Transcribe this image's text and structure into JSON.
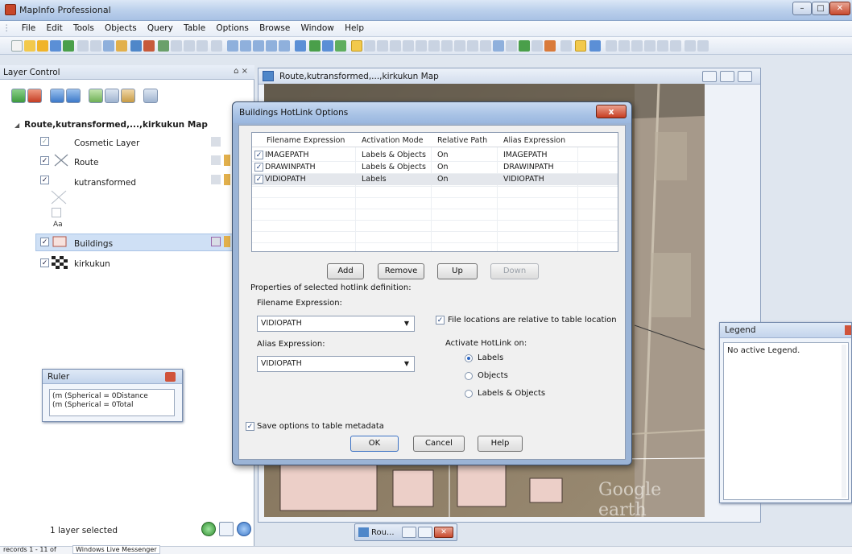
{
  "app": {
    "title": "MapInfo Professional"
  },
  "menu": [
    "File",
    "Edit",
    "Tools",
    "Objects",
    "Query",
    "Table",
    "Options",
    "Browse",
    "Window",
    "Help"
  ],
  "layer_control": {
    "title": "Layer Control",
    "close_glyph": "⌂ ×",
    "map_name": "Route,kutransformed,...,kirkukun Map",
    "layers": [
      {
        "name": "Cosmetic Layer",
        "checked": true
      },
      {
        "name": "Route",
        "checked": true
      },
      {
        "name": "kutransformed",
        "checked": true
      },
      {
        "name": "Buildings",
        "checked": true,
        "selected": true
      },
      {
        "name": "kirkukun",
        "checked": true
      }
    ],
    "sample_text": "Aa",
    "status": "1 layer selected"
  },
  "ruler": {
    "title": "Ruler",
    "lines": [
      "(m (Spherical = 0Distance",
      "(m (Spherical = 0Total"
    ]
  },
  "map_window": {
    "title": "Route,kutransformed,...,kirkukun Map",
    "watermark": "Google earth",
    "taskbar_label": "Rou..."
  },
  "legend": {
    "title": "Legend",
    "body": "No active Legend."
  },
  "dialog": {
    "title": "Buildings HotLink Options",
    "close": "x",
    "columns": [
      "Filename Expression",
      "Activation Mode",
      "Relative Path",
      "Alias Expression"
    ],
    "rows": [
      {
        "filename": "IMAGEPATH",
        "mode": "Labels & Objects",
        "relative": "On",
        "alias": "IMAGEPATH"
      },
      {
        "filename": "DRAWINPATH",
        "mode": "Labels & Objects",
        "relative": "On",
        "alias": "DRAWINPATH"
      },
      {
        "filename": "VIDIOPATH",
        "mode": "Labels",
        "relative": "On",
        "alias": "VIDIOPATH"
      }
    ],
    "buttons": {
      "add": "Add",
      "remove": "Remove",
      "up": "Up",
      "down": "Down"
    },
    "properties_label": "Properties of selected hotlink definition:",
    "filename_label": "Filename Expression:",
    "filename_value": "VIDIOPATH",
    "alias_label": "Alias Expression:",
    "alias_value": "VIDIOPATH",
    "relative_checkbox": "File locations are relative to table location",
    "activate_label": "Activate HotLink on:",
    "activate_options": [
      "Labels",
      "Objects",
      "Labels & Objects"
    ],
    "activate_selected": "Labels",
    "save_checkbox": "Save options to table metadata",
    "ok": "OK",
    "cancel": "Cancel",
    "help": "Help"
  },
  "status_bar": {
    "records": "records 1 - 11 of",
    "messenger": "Windows Live Messenger"
  }
}
